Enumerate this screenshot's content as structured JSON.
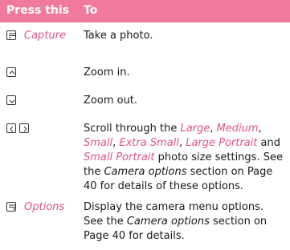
{
  "table": {
    "header": {
      "col1": "Press this",
      "col2": "To"
    },
    "rows": [
      {
        "key_label": "Capture",
        "icon": "softkey-left-icon",
        "desc": "Take a photo."
      },
      {
        "icon": "nav-up-icon",
        "desc": "Zoom in."
      },
      {
        "icon": "nav-down-icon",
        "desc": "Zoom out."
      },
      {
        "icons": [
          "nav-left-icon",
          "nav-right-icon"
        ],
        "desc_parts": {
          "t1": "Scroll through the ",
          "large": "Large",
          "sep1": ", ",
          "medium": "Medium",
          "sep2": ",",
          "small": "Small",
          "sep3": ", ",
          "extra_small": "Extra Small",
          "sep4": ", ",
          "large_portrait": "Large Portrait",
          "and": " and",
          "small_portrait": "Small Portrait",
          "t2": " photo size settings. See the ",
          "ref": "Camera options",
          "t3": " section on Page 40 for details of these options."
        }
      },
      {
        "key_label": "Options",
        "icon": "softkey-right-icon",
        "desc_parts": {
          "t1": "Display the camera menu options. See the ",
          "ref": "Camera options",
          "t2": " section on Page 40 for details."
        }
      }
    ]
  },
  "colors": {
    "header_bg": "#f07a9c",
    "accent": "#e5527e"
  }
}
